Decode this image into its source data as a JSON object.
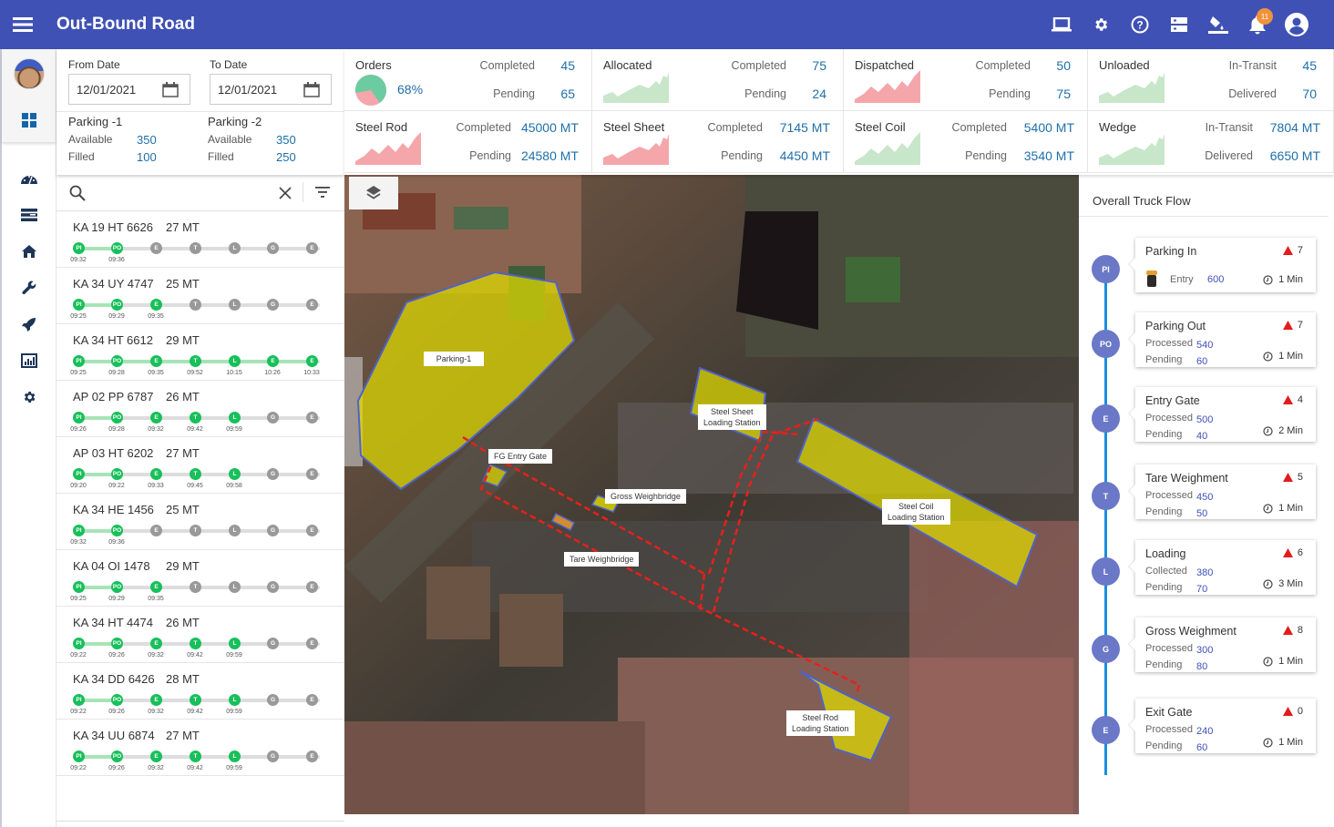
{
  "app": {
    "title": "Out-Bound Road",
    "notification_count": "11"
  },
  "header_icons": [
    "laptop-icon",
    "gear-icon",
    "help-icon",
    "storage-icon",
    "paint-bucket-icon",
    "bell-icon",
    "account-icon"
  ],
  "rail": {
    "items": [
      "dashboard-icon",
      "gauge-icon",
      "list-icon",
      "home-icon",
      "wrench-icon",
      "rocket-icon",
      "chart-icon",
      "settings-icon"
    ]
  },
  "filters": {
    "from_label": "From Date",
    "from_value": "12/01/2021",
    "to_label": "To Date",
    "to_value": "12/01/2021",
    "parking": [
      {
        "name": "Parking -1",
        "available_label": "Available",
        "available": "350",
        "filled_label": "Filled",
        "filled": "100"
      },
      {
        "name": "Parking -2",
        "available_label": "Available",
        "available": "350",
        "filled_label": "Filled",
        "filled": "250"
      }
    ]
  },
  "stats": [
    {
      "name": "Orders",
      "l1": "Completed",
      "v1": "45",
      "l2": "Pending",
      "v2": "65",
      "percent": "68%",
      "percent_value": 68
    },
    {
      "name": "Allocated",
      "l1": "Completed",
      "v1": "75",
      "l2": "Pending",
      "v2": "24",
      "color": "#c8e6c9"
    },
    {
      "name": "Dispatched",
      "l1": "Completed",
      "v1": "50",
      "l2": "Pending",
      "v2": "75",
      "color": "#f4a6ab"
    },
    {
      "name": "Unloaded",
      "l1": "In-Transit",
      "v1": "45",
      "l2": "Delivered",
      "v2": "70",
      "color": "#c8e6c9"
    },
    {
      "name": "Steel Rod",
      "l1": "Completed",
      "v1": "45000 MT",
      "l2": "Pending",
      "v2": "24580 MT",
      "color": "#f4a6ab"
    },
    {
      "name": "Steel Sheet",
      "l1": "Completed",
      "v1": "7145 MT",
      "l2": "Pending",
      "v2": "4450 MT",
      "color": "#f4a6ab"
    },
    {
      "name": "Steel Coil",
      "l1": "Completed",
      "v1": "5400 MT",
      "l2": "Pending",
      "v2": "3540 MT",
      "color": "#c8e6c9"
    },
    {
      "name": "Wedge",
      "l1": "In-Transit",
      "v1": "7804 MT",
      "l2": "Delivered",
      "v2": "6650 MT",
      "color": "#c8e6c9"
    }
  ],
  "search": {
    "placeholder": ""
  },
  "stage_codes": [
    "PI",
    "PO",
    "E",
    "T",
    "L",
    "G",
    "E"
  ],
  "trucks": [
    {
      "plate": "KA 19 HT 6626",
      "weight": "27 MT",
      "times": [
        "09:32",
        "09:36"
      ],
      "fill_to": 1
    },
    {
      "plate": "KA 34 UY 4747",
      "weight": "25 MT",
      "times": [
        "09:25",
        "09:29",
        "09:35"
      ],
      "fill_to": 1
    },
    {
      "plate": "KA 34 HT 6612",
      "weight": "29 MT",
      "times": [
        "09:25",
        "09:28",
        "09:35",
        "09:52",
        "10:15",
        "10:26",
        "10:33"
      ],
      "fill_to": 6,
      "codes": [
        "PI",
        "PO",
        "E",
        "T",
        "L",
        "E",
        "E"
      ]
    },
    {
      "plate": "AP 02 PP 6787",
      "weight": "26 MT",
      "times": [
        "09:26",
        "09:28",
        "09:32",
        "09:42",
        "09:59"
      ],
      "fill_to": 1
    },
    {
      "plate": "AP 03 HT 6202",
      "weight": "27 MT",
      "times": [
        "09:20",
        "09:22",
        "09:33",
        "09:45",
        "09:58"
      ],
      "fill_to": 1
    },
    {
      "plate": "KA 34 HE 1456",
      "weight": "25 MT",
      "times": [
        "09:32",
        "09:36"
      ],
      "fill_to": 1
    },
    {
      "plate": "KA 04 OI 1478",
      "weight": "29 MT",
      "times": [
        "09:25",
        "09:29",
        "09:35"
      ],
      "fill_to": 1
    },
    {
      "plate": "KA 34 HT 4474",
      "weight": "26 MT",
      "times": [
        "09:22",
        "09:26",
        "09:32",
        "09:42",
        "09:59"
      ],
      "fill_to": 1
    },
    {
      "plate": "KA 34 DD 6426",
      "weight": "28 MT",
      "times": [
        "09:22",
        "09:26",
        "09:32",
        "09:42",
        "09:59"
      ],
      "fill_to": 1
    },
    {
      "plate": "KA 34 UU 6874",
      "weight": "27 MT",
      "times": [
        "09:22",
        "09:26",
        "09:32",
        "09:42",
        "09:59"
      ],
      "fill_to": 1
    }
  ],
  "map": {
    "labels": [
      {
        "id": "parking-1",
        "text": "Parking-1"
      },
      {
        "id": "steel-sheet",
        "text": "Steel Sheet\nLoading Station"
      },
      {
        "id": "fg-entry",
        "text": "FG Entry Gate"
      },
      {
        "id": "gross-wb",
        "text": "Gross Weighbridge"
      },
      {
        "id": "steel-coil",
        "text": "Steel Coil\nLoading Station"
      },
      {
        "id": "tare-wb",
        "text": "Tare Weighbridge"
      },
      {
        "id": "steel-rod",
        "text": "Steel Rod\nLoading Station"
      }
    ]
  },
  "flow": {
    "title": "Overall Truck Flow",
    "stages": [
      {
        "code": "PI",
        "name": "Parking In",
        "alerts": "7",
        "k1": "Entry",
        "v1": "600",
        "time": "1 Min"
      },
      {
        "code": "PO",
        "name": "Parking Out",
        "alerts": "7",
        "k1": "Processed",
        "v1": "540",
        "k2": "Pending",
        "v2": "60",
        "time": "1 Min"
      },
      {
        "code": "E",
        "name": "Entry Gate",
        "alerts": "4",
        "k1": "Processed",
        "v1": "500",
        "k2": "Pending",
        "v2": "40",
        "time": "2 Min"
      },
      {
        "code": "T",
        "name": "Tare Weighment",
        "alerts": "5",
        "k1": "Processed",
        "v1": "450",
        "k2": "Pending",
        "v2": "50",
        "time": "1 Min"
      },
      {
        "code": "L",
        "name": "Loading",
        "alerts": "6",
        "k1": "Collected",
        "v1": "380",
        "k2": "Pending",
        "v2": "70",
        "time": "3 Min"
      },
      {
        "code": "G",
        "name": "Gross  Weighment",
        "alerts": "8",
        "k1": "Processed",
        "v1": "300",
        "k2": "Pending",
        "v2": "80",
        "time": "1 Min"
      },
      {
        "code": "E",
        "name": "Exit Gate",
        "alerts": "0",
        "k1": "Processed",
        "v1": "240",
        "k2": "Pending",
        "v2": "60",
        "time": "1 Min"
      }
    ]
  }
}
